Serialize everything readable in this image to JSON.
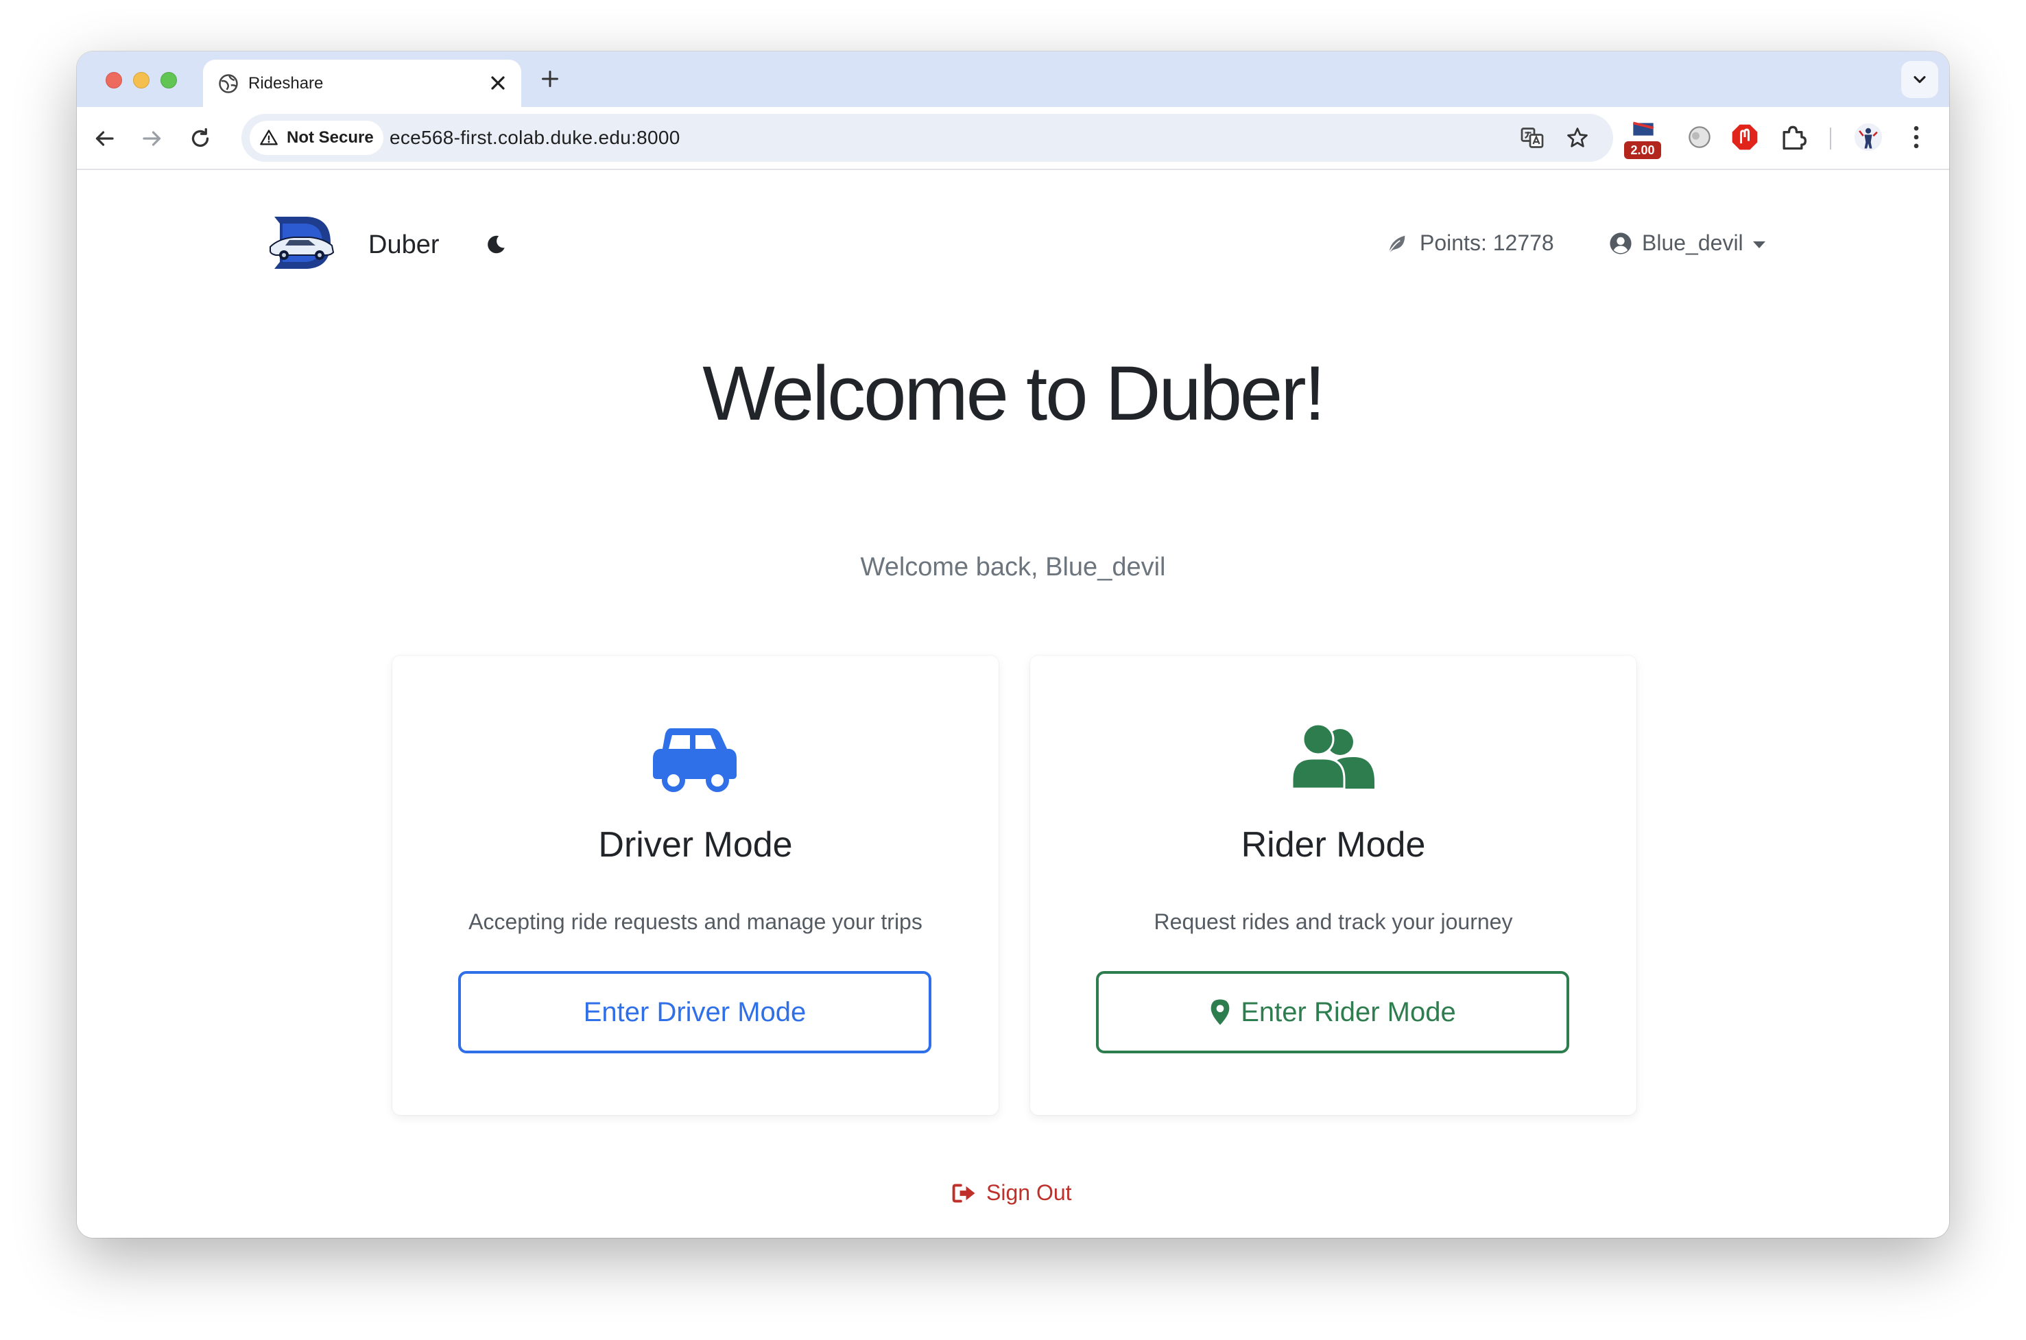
{
  "browser": {
    "tab_title": "Rideshare",
    "security_label": "Not Secure",
    "url": "ece568-first.colab.duke.edu:8000",
    "extension_badge": "2.00"
  },
  "navbar": {
    "brand": "Duber",
    "points": "Points: 12778",
    "username": "Blue_devil"
  },
  "hero": {
    "title": "Welcome to Duber!",
    "subtitle": "Welcome back, Blue_devil"
  },
  "cards": [
    {
      "title": "Driver Mode",
      "description": "Accepting ride requests and manage your trips",
      "button": "Enter Driver Mode",
      "icon": "car-icon",
      "color": "#2f6fe8"
    },
    {
      "title": "Rider Mode",
      "description": "Request rides and track your journey",
      "button": "Enter Rider Mode",
      "icon": "users-icon",
      "color": "#2e7d4f"
    }
  ],
  "footer": {
    "signout": "Sign Out",
    "signout_color": "#c0302b"
  }
}
